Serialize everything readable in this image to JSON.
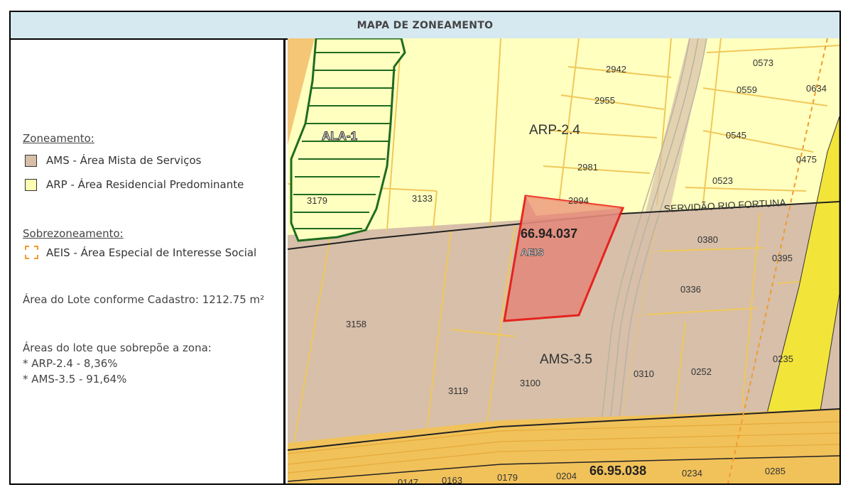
{
  "header": {
    "title": "MAPA DE ZONEAMENTO"
  },
  "legend": {
    "zoneamento_title": "Zoneamento:",
    "zoneamento_items": [
      {
        "label": "AMS - Área Mista de Serviços",
        "color": "#d7bfa9"
      },
      {
        "label": "ARP - Área Residencial Predominante",
        "color": "#ffffb3"
      }
    ],
    "sobre_title": "Sobrezoneamento:",
    "sobre_items": [
      {
        "label": "AEIS - Área Especial de Interesse Social",
        "color": "#f29a2e"
      }
    ],
    "area_lote": "Área do Lote conforme Cadastro: 1212.75 m²",
    "sobrepoe_title": "Áreas do lote que sobrepõe a zona:",
    "sobrepoe_items": [
      "* ARP-2.4 - 8,36%",
      "* AMS-3.5 - 91,64%"
    ]
  },
  "map": {
    "colors": {
      "arp": "#ffffc0",
      "ams": "#d7bfa9",
      "road": "#f1c25a",
      "lot_outline": "#e8120f",
      "ala": "#1f6b1f"
    },
    "zone_labels": [
      "ALA-1",
      "ARP-2.4",
      "AMS-3.5"
    ],
    "street": "SERVIDÃO RIO FORTUNA",
    "lot_ids": [
      "66.94.037",
      "66.95.038"
    ],
    "aeis_label": "AEIS",
    "parcels": [
      "2942",
      "0573",
      "0559",
      "0634",
      "2955",
      "0545",
      "0475",
      "2981",
      "0523",
      "3179",
      "3133",
      "2994",
      "0380",
      "0395",
      "0336",
      "3158",
      "0235",
      "0252",
      "0310",
      "3100",
      "3119",
      "0285",
      "0234",
      "0204",
      "0179",
      "0163",
      "0147"
    ]
  }
}
